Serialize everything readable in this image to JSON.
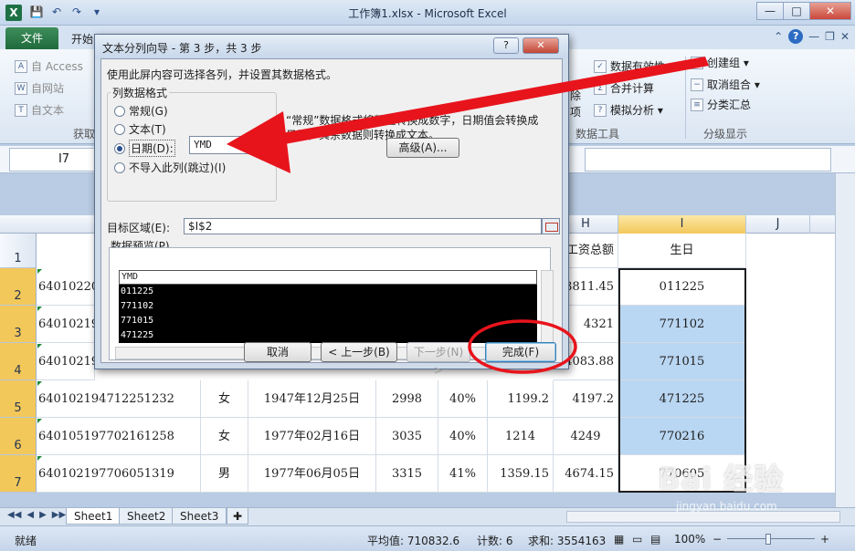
{
  "window": {
    "title": "工作簿1.xlsx - Microsoft Excel",
    "app_icon": "X",
    "controls": {
      "minimize": "—",
      "maximize": "□",
      "close": "✕"
    }
  },
  "qat": {
    "save": "💾",
    "undo": "↶",
    "redo": "↷",
    "more": "▾"
  },
  "tabs": {
    "file": "文件",
    "start": "开始",
    "help": "?"
  },
  "ribbon": {
    "left": [
      {
        "label": "自 Access",
        "icon": "A"
      },
      {
        "label": "自网站",
        "icon": "W"
      },
      {
        "label": "自文本",
        "icon": "T"
      }
    ],
    "left_group": "获取",
    "mid": [
      {
        "label": "除",
        "top": true
      },
      {
        "label": "项",
        "top": false
      }
    ],
    "data_tools": [
      {
        "label": "数据有效性 ▾",
        "icon": "✓"
      },
      {
        "label": "合并计算",
        "icon": "Σ"
      },
      {
        "label": "模拟分析 ▾",
        "icon": "?"
      }
    ],
    "data_tools_group": "数据工具",
    "outline": [
      {
        "label": "创建组 ▾",
        "icon": "+"
      },
      {
        "label": "取消组合 ▾",
        "icon": "−"
      },
      {
        "label": "分类汇总",
        "icon": "≡"
      }
    ],
    "outline_group": "分级显示"
  },
  "namebox": {
    "value": "I7"
  },
  "columns": [
    {
      "label": "H",
      "sel": false
    },
    {
      "label": "I",
      "sel": true
    },
    {
      "label": "J",
      "sel": false
    }
  ],
  "rows": [
    {
      "num": "1",
      "cells": [
        "",
        "",
        "",
        "",
        "",
        "",
        "工资总额",
        "生日"
      ]
    },
    {
      "num": "2",
      "cells": [
        "64010220",
        "",
        "",
        "",
        "",
        "",
        "3811.45",
        "011225"
      ]
    },
    {
      "num": "3",
      "cells": [
        "64010219",
        "",
        "",
        "",
        "",
        "",
        "4321",
        "771102"
      ]
    },
    {
      "num": "4",
      "cells": [
        "64010219",
        "",
        "",
        "",
        "",
        "",
        "4083.88",
        "771015"
      ]
    },
    {
      "num": "5",
      "cells": [
        "640102194712251232",
        "女",
        "1947年12月25日",
        "2998",
        "40%",
        "1199.2",
        "4197.2",
        "471225"
      ]
    },
    {
      "num": "6",
      "cells": [
        "640105197702161258",
        "女",
        "1977年02月16日",
        "3035",
        "40%",
        "1214",
        "4249",
        "770216"
      ]
    },
    {
      "num": "7",
      "cells": [
        "640102197706051319",
        "男",
        "1977年06月05日",
        "3315",
        "41%",
        "1359.15",
        "4674.15",
        "770605"
      ]
    }
  ],
  "sheets": [
    "Sheet1",
    "Sheet2",
    "Sheet3"
  ],
  "sheet_nav": [
    "◀◀",
    "◀",
    "▶",
    "▶▶"
  ],
  "status": {
    "ready": "就绪",
    "average": "平均值: 710832.6",
    "count": "计数: 6",
    "sum": "求和: 3554163",
    "zoom": "100%",
    "zoom_minus": "−",
    "zoom_plus": "+"
  },
  "dialog": {
    "title": "文本分列向导 - 第 3 步，共 3 步",
    "help": "?",
    "close": "✕",
    "intro": "使用此屏内容可选择各列，并设置其数据格式。",
    "group_label": "列数据格式",
    "options": [
      {
        "label": "常规(G)",
        "checked": false
      },
      {
        "label": "文本(T)",
        "checked": false
      },
      {
        "label": "日期(D):",
        "checked": true
      },
      {
        "label": "不导入此列(跳过)(I)",
        "checked": false
      }
    ],
    "date_format": "YMD",
    "desc_line1": "“常规”数据格式将数值转换成数字，日期值会转换成",
    "desc_line2": "日期，其余数据则转换成文本。",
    "advanced_btn": "高级(A)...",
    "target_label": "目标区域(E):",
    "target_value": "$I$2",
    "preview_label": "数据预览(P)",
    "preview_header": "YMD",
    "preview_rows": [
      "011225",
      "771102",
      "771015",
      "471225"
    ],
    "buttons": {
      "cancel": "取消",
      "back": "< 上一步(B)",
      "next": "下一步(N) >",
      "finish": "完成(F)"
    }
  },
  "watermark": {
    "main": "Bai 经验",
    "sub": "jingyan.baidu.com"
  },
  "colors": {
    "annotation_red": "#e8141c",
    "excel_green": "#1e7145",
    "selection_blue": "#b9d6f2"
  }
}
